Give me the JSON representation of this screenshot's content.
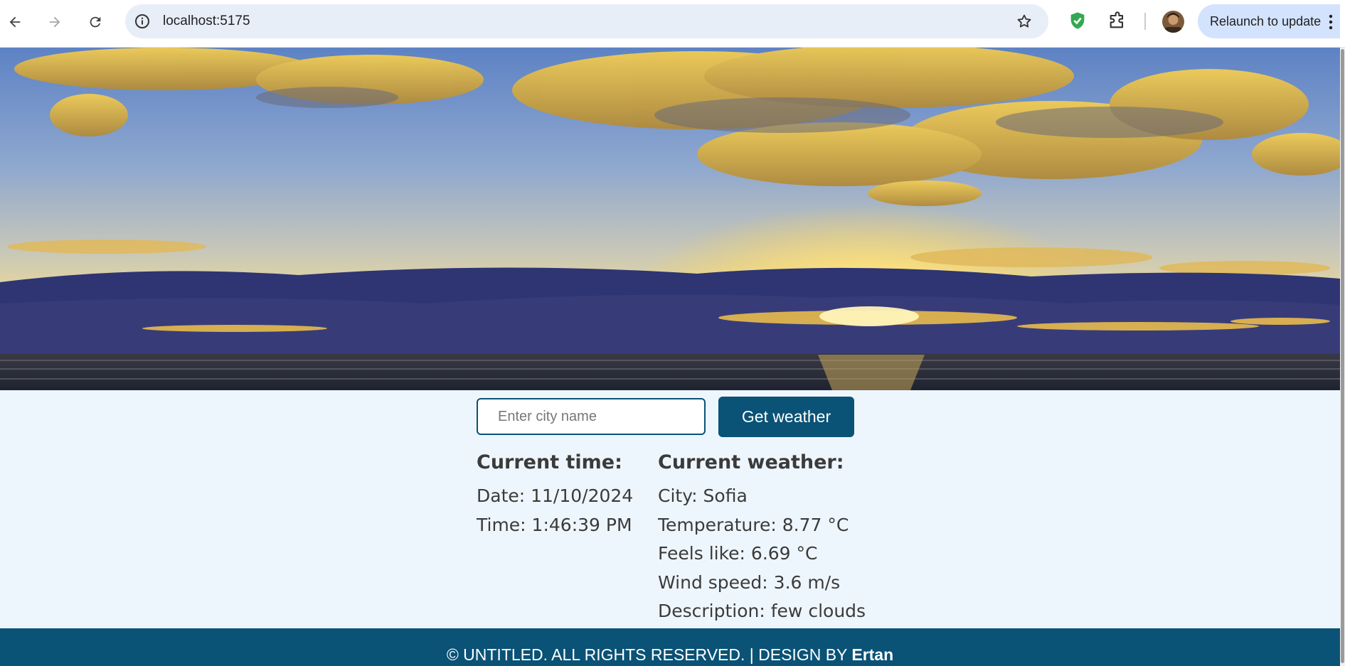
{
  "browser": {
    "url": "localhost:5175",
    "relaunch_label": "Relaunch to update"
  },
  "search": {
    "placeholder": "Enter city name",
    "value": "",
    "button_label": "Get weather"
  },
  "time_panel": {
    "heading": "Current time:",
    "date": "Date: 11/10/2024",
    "time": "Time: 1:46:39 PM"
  },
  "weather_panel": {
    "heading": "Current weather:",
    "city": "City: Sofia",
    "temperature": "Temperature: 8.77 °C",
    "feels_like": "Feels like: 6.69 °C",
    "wind_speed": "Wind speed: 3.6 m/s",
    "description": "Description: few clouds"
  },
  "footer": {
    "text": "© UNTITLED. ALL RIGHTS RESERVED. | DESIGN BY ",
    "author": "Ertan"
  },
  "colors": {
    "brand": "#0a5276",
    "page_bg": "#eef6fd"
  }
}
